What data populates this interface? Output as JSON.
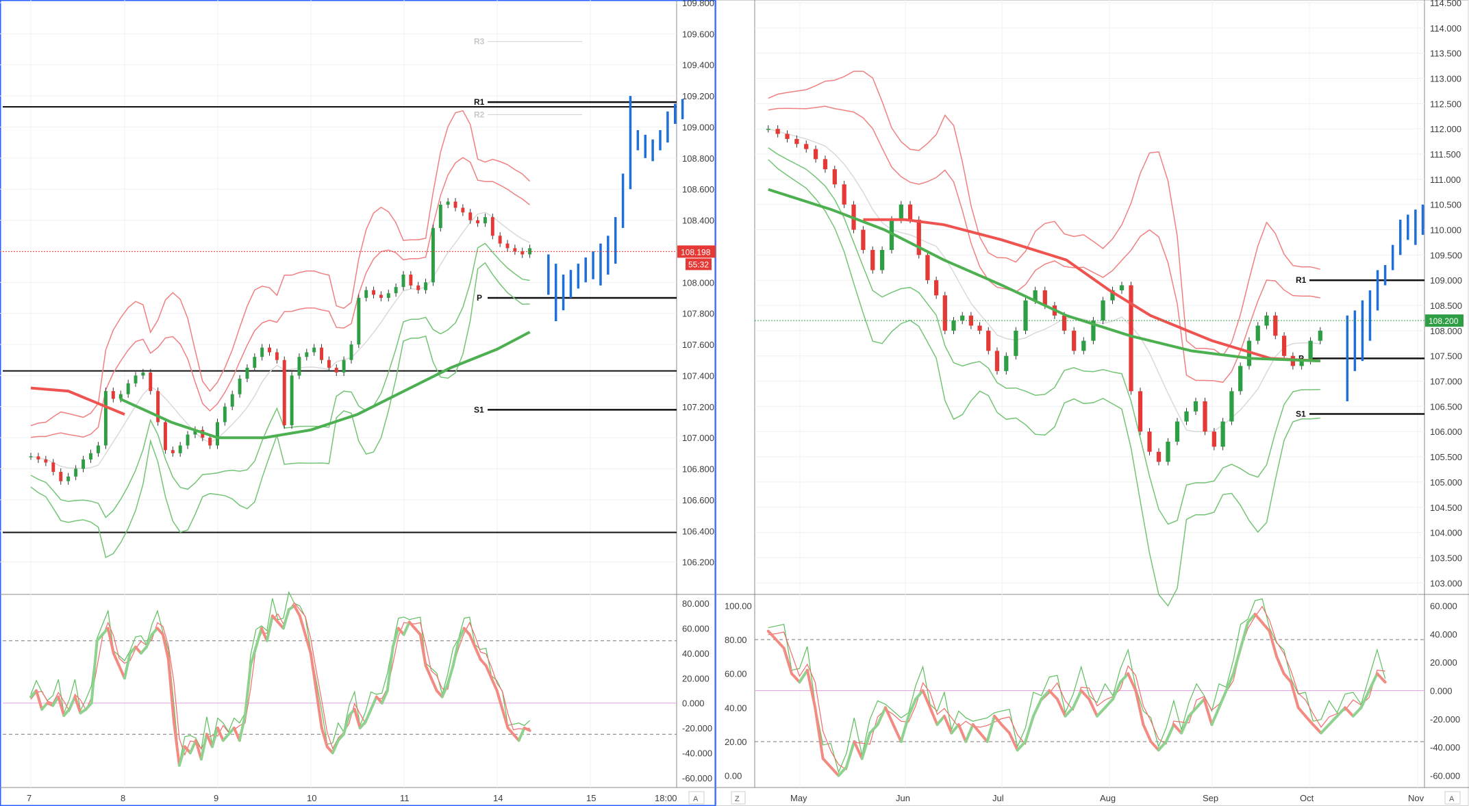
{
  "chart_data": [
    {
      "type": "candlestick",
      "panel": "left-price",
      "ylim": [
        106.0,
        109.8
      ],
      "y_ticks": [
        "109.800",
        "109.600",
        "109.400",
        "109.200",
        "109.000",
        "108.800",
        "108.600",
        "108.400",
        "108.200",
        "108.000",
        "107.800",
        "107.600",
        "107.400",
        "107.200",
        "107.000",
        "106.800",
        "106.600",
        "106.400",
        "106.200"
      ],
      "x_ticks": [
        "7",
        "8",
        "9",
        "10",
        "11",
        "14",
        "15",
        "18:00"
      ],
      "last_price": "108.198",
      "countdown": "55:32",
      "horizontal_lines": [
        109.13,
        107.43,
        106.39
      ],
      "pivot_levels": [
        {
          "label": "R3",
          "value": 109.55,
          "faint": true
        },
        {
          "label": "R1",
          "value": 109.16,
          "faint": false
        },
        {
          "label": "R2",
          "value": 109.08,
          "faint": true
        },
        {
          "label": "P",
          "value": 107.9,
          "faint": false
        },
        {
          "label": "S1",
          "value": 107.18,
          "faint": false
        }
      ],
      "candles_start_x": 0,
      "candles_end_x": 5.35,
      "candles": [
        106.88,
        106.86,
        106.84,
        106.78,
        106.72,
        106.75,
        106.8,
        106.86,
        106.9,
        106.95,
        107.3,
        107.25,
        107.28,
        107.35,
        107.4,
        107.42,
        107.3,
        107.1,
        106.92,
        106.9,
        106.95,
        107.02,
        107.05,
        107.0,
        106.95,
        107.1,
        107.2,
        107.28,
        107.38,
        107.45,
        107.52,
        107.58,
        107.55,
        107.5,
        107.08,
        107.4,
        107.52,
        107.55,
        107.58,
        107.5,
        107.45,
        107.42,
        107.5,
        107.6,
        107.9,
        107.95,
        107.92,
        107.9,
        107.93,
        107.97,
        108.05,
        107.98,
        107.95,
        108.0,
        108.35,
        108.5,
        108.52,
        108.48,
        108.45,
        108.4,
        108.38,
        108.42,
        108.3,
        108.25,
        108.22,
        108.2,
        108.18,
        108.22
      ],
      "blue_bars": [
        {
          "x": 5.55,
          "h": 108.18,
          "l": 107.92
        },
        {
          "x": 5.63,
          "h": 108.12,
          "l": 107.75
        },
        {
          "x": 5.71,
          "h": 108.05,
          "l": 107.82
        },
        {
          "x": 5.79,
          "h": 108.08,
          "l": 107.9
        },
        {
          "x": 5.87,
          "h": 108.12,
          "l": 107.96
        },
        {
          "x": 5.95,
          "h": 108.16,
          "l": 108.0
        },
        {
          "x": 6.03,
          "h": 108.2,
          "l": 108.02
        },
        {
          "x": 6.11,
          "h": 108.25,
          "l": 107.98
        },
        {
          "x": 6.19,
          "h": 108.3,
          "l": 108.05
        },
        {
          "x": 6.27,
          "h": 108.42,
          "l": 108.12
        },
        {
          "x": 6.35,
          "h": 108.7,
          "l": 108.35
        },
        {
          "x": 6.43,
          "h": 109.2,
          "l": 108.6
        },
        {
          "x": 6.51,
          "h": 108.98,
          "l": 108.85
        },
        {
          "x": 6.59,
          "h": 108.95,
          "l": 108.8
        },
        {
          "x": 6.67,
          "h": 108.92,
          "l": 108.78
        },
        {
          "x": 6.75,
          "h": 108.98,
          "l": 108.85
        },
        {
          "x": 6.83,
          "h": 109.1,
          "l": 108.9
        },
        {
          "x": 6.91,
          "h": 109.15,
          "l": 109.02
        },
        {
          "x": 6.99,
          "h": 109.18,
          "l": 109.05
        }
      ],
      "ema_green_points": [
        [
          0.95,
          107.25
        ],
        [
          1.5,
          107.1
        ],
        [
          2.0,
          107.0
        ],
        [
          2.5,
          107.0
        ],
        [
          3.0,
          107.05
        ],
        [
          3.5,
          107.15
        ],
        [
          4.0,
          107.3
        ],
        [
          4.5,
          107.45
        ],
        [
          5.0,
          107.57
        ],
        [
          5.35,
          107.68
        ]
      ],
      "ema_red_points": [
        [
          0,
          107.32
        ],
        [
          0.4,
          107.3
        ],
        [
          0.8,
          107.2
        ],
        [
          1.0,
          107.15
        ]
      ]
    },
    {
      "type": "oscillator",
      "panel": "left-stochastic",
      "ylim": [
        -65,
        85
      ],
      "y_ticks": [
        "80.000",
        "60.000",
        "40.000",
        "20.000",
        "0.000",
        "-20.000",
        "-40.000",
        "-60.000"
      ],
      "levels": [
        50,
        0,
        -25
      ],
      "k_values": [
        5,
        10,
        -5,
        0,
        -2,
        5,
        -10,
        -5,
        5,
        -8,
        -5,
        0,
        50,
        55,
        60,
        40,
        30,
        20,
        40,
        45,
        40,
        45,
        55,
        60,
        55,
        35,
        -15,
        -50,
        -35,
        -40,
        -30,
        -45,
        -25,
        -35,
        -20,
        -30,
        -25,
        -20,
        -30,
        -10,
        30,
        45,
        60,
        50,
        70,
        65,
        60,
        75,
        78,
        70,
        55,
        40,
        10,
        -20,
        -35,
        -40,
        -30,
        -25,
        -10,
        -5,
        -20,
        -15,
        -5,
        5,
        0,
        10,
        45,
        60,
        55,
        65,
        60,
        55,
        30,
        20,
        10,
        5,
        15,
        30,
        50,
        60,
        55,
        45,
        35,
        30,
        20,
        10,
        -5,
        -20,
        -25,
        -30,
        -20,
        -22
      ],
      "k_start_x": 0,
      "k_end_x": 5.35
    },
    {
      "type": "candlestick",
      "panel": "right-price",
      "ylim": [
        102.8,
        114.5
      ],
      "y_ticks": [
        "114.500",
        "114.000",
        "113.500",
        "113.000",
        "112.500",
        "112.000",
        "111.500",
        "111.000",
        "110.500",
        "110.000",
        "109.500",
        "109.000",
        "108.500",
        "108.000",
        "107.500",
        "107.000",
        "106.500",
        "106.000",
        "105.500",
        "105.000",
        "104.500",
        "104.000",
        "103.500",
        "103.000"
      ],
      "x_ticks": [
        "May",
        "Jun",
        "Jul",
        "Aug",
        "Sep",
        "Oct",
        "Nov"
      ],
      "last_price": "108.200",
      "horizontal_lines": [],
      "pivot_levels": [
        {
          "label": "R1",
          "value": 109.0,
          "faint": false
        },
        {
          "label": "P",
          "value": 107.45,
          "faint": false
        },
        {
          "label": "S1",
          "value": 106.35,
          "faint": false
        }
      ],
      "candles_start_x": -0.3,
      "candles_end_x": 5.1,
      "candles": [
        112.0,
        111.9,
        111.8,
        111.7,
        111.6,
        111.4,
        111.2,
        110.9,
        110.5,
        110.0,
        109.6,
        109.2,
        109.6,
        110.2,
        110.5,
        110.2,
        109.5,
        109.0,
        108.7,
        108.0,
        108.2,
        108.3,
        108.1,
        108.0,
        107.6,
        107.2,
        107.5,
        108.0,
        108.6,
        108.8,
        108.5,
        108.3,
        108.0,
        107.6,
        107.8,
        108.2,
        108.6,
        108.8,
        108.9,
        106.8,
        106.0,
        105.6,
        105.4,
        105.8,
        106.2,
        106.4,
        106.6,
        106.0,
        105.7,
        106.2,
        106.8,
        107.3,
        107.8,
        108.1,
        108.3,
        107.9,
        107.5,
        107.3,
        107.4,
        107.8,
        108.0
      ],
      "blue_bars": [
        {
          "x": 5.35,
          "h": 108.3,
          "l": 106.6
        },
        {
          "x": 5.42,
          "h": 108.4,
          "l": 107.2
        },
        {
          "x": 5.49,
          "h": 108.6,
          "l": 107.4
        },
        {
          "x": 5.56,
          "h": 108.8,
          "l": 107.8
        },
        {
          "x": 5.63,
          "h": 109.2,
          "l": 108.4
        },
        {
          "x": 5.7,
          "h": 109.3,
          "l": 108.9
        },
        {
          "x": 5.77,
          "h": 109.7,
          "l": 109.2
        },
        {
          "x": 5.84,
          "h": 110.2,
          "l": 109.5
        },
        {
          "x": 5.91,
          "h": 110.3,
          "l": 109.8
        },
        {
          "x": 5.98,
          "h": 110.4,
          "l": 109.7
        },
        {
          "x": 6.05,
          "h": 110.5,
          "l": 109.9
        }
      ],
      "ema_green_points": [
        [
          -0.3,
          110.8
        ],
        [
          0.3,
          110.4
        ],
        [
          0.8,
          110.0
        ],
        [
          1.4,
          109.4
        ],
        [
          2.0,
          108.9
        ],
        [
          2.6,
          108.3
        ],
        [
          3.2,
          107.9
        ],
        [
          3.8,
          107.6
        ],
        [
          4.4,
          107.45
        ],
        [
          5.1,
          107.4
        ]
      ],
      "ema_red_points": [
        [
          0.6,
          110.2
        ],
        [
          1.0,
          110.2
        ],
        [
          1.4,
          110.1
        ],
        [
          2.0,
          109.8
        ],
        [
          2.6,
          109.4
        ],
        [
          3.0,
          108.8
        ],
        [
          3.4,
          108.3
        ],
        [
          4.0,
          107.8
        ],
        [
          4.6,
          107.45
        ],
        [
          5.1,
          107.4
        ]
      ]
    },
    {
      "type": "oscillator",
      "panel": "right-stochastic",
      "ylim": [
        -5,
        105
      ],
      "y_ticks_left": [
        "100.00",
        "80.00",
        "60.00",
        "40.00",
        "20.00",
        "0.00"
      ],
      "y_ticks_right": [
        "60.000",
        "40.000",
        "20.000",
        "0.000",
        "-20.000",
        "-40.000",
        "-60.000"
      ],
      "levels": [
        80,
        50,
        20
      ],
      "k_values": [
        85,
        80,
        75,
        60,
        55,
        62,
        40,
        10,
        5,
        0,
        5,
        20,
        10,
        25,
        30,
        40,
        30,
        20,
        35,
        45,
        50,
        40,
        30,
        35,
        25,
        30,
        20,
        30,
        25,
        20,
        35,
        30,
        25,
        15,
        20,
        35,
        45,
        50,
        45,
        35,
        40,
        50,
        45,
        35,
        40,
        45,
        55,
        60,
        50,
        30,
        20,
        15,
        20,
        30,
        25,
        35,
        40,
        45,
        30,
        40,
        50,
        60,
        75,
        90,
        95,
        90,
        85,
        70,
        60,
        55,
        40,
        35,
        30,
        25,
        30,
        35,
        40,
        35,
        40,
        50,
        60,
        55
      ],
      "k_start_x": -0.3,
      "k_end_x": 5.7
    }
  ]
}
